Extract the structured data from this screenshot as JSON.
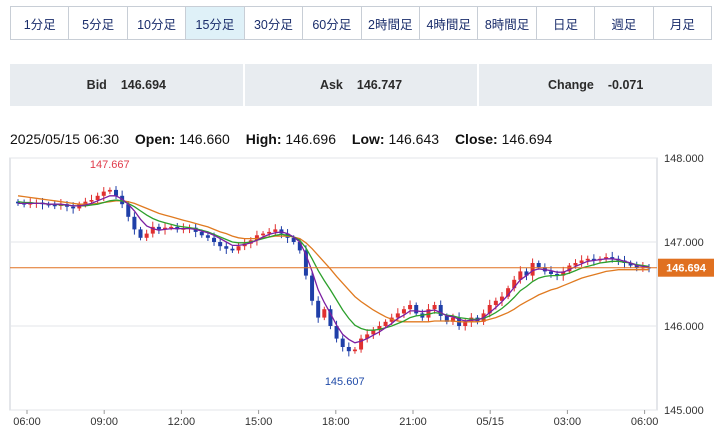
{
  "timeframe_tabs": [
    {
      "label": "1分足",
      "active": false
    },
    {
      "label": "5分足",
      "active": false
    },
    {
      "label": "10分足",
      "active": false
    },
    {
      "label": "15分足",
      "active": true
    },
    {
      "label": "30分足",
      "active": false
    },
    {
      "label": "60分足",
      "active": false
    },
    {
      "label": "2時間足",
      "active": false
    },
    {
      "label": "4時間足",
      "active": false
    },
    {
      "label": "8時間足",
      "active": false
    },
    {
      "label": "日足",
      "active": false
    },
    {
      "label": "週足",
      "active": false
    },
    {
      "label": "月足",
      "active": false
    }
  ],
  "quotes": {
    "bid_label": "Bid",
    "bid_value": "146.694",
    "ask_label": "Ask",
    "ask_value": "146.747",
    "change_label": "Change",
    "change_value": "-0.071"
  },
  "ohlc": {
    "datetime": "2025/05/15 06:30",
    "open_label": "Open:",
    "open": "146.660",
    "high_label": "High:",
    "high": "146.696",
    "low_label": "Low:",
    "low": "146.643",
    "close_label": "Close:",
    "close": "146.694"
  },
  "colors": {
    "up": "#e03030",
    "down": "#1f3fa8",
    "current_line": "#e07020",
    "ma_green": "#2ca02c",
    "ma_orange": "#e07a20",
    "ma_purple": "#7b1fa2",
    "high_label": "#e03a4a",
    "low_label": "#1f4aa8"
  },
  "chart_data": {
    "type": "candlestick",
    "ylim": [
      145.0,
      148.0
    ],
    "y_ticks": [
      "148.000",
      "147.000",
      "146.000",
      "145.000"
    ],
    "x_ticks": [
      "06:00",
      "09:00",
      "12:00",
      "15:00",
      "18:00",
      "21:00",
      "05/15",
      "03:00",
      "06:00"
    ],
    "current_price": "146.694",
    "high_marker": {
      "label": "147.667",
      "value": 147.667
    },
    "low_marker": {
      "label": "145.607",
      "value": 145.607
    },
    "close_series": [
      147.46,
      147.45,
      147.46,
      147.47,
      147.45,
      147.44,
      147.43,
      147.45,
      147.42,
      147.4,
      147.45,
      147.48,
      147.5,
      147.55,
      147.6,
      147.62,
      147.55,
      147.45,
      147.3,
      147.15,
      147.05,
      147.1,
      147.18,
      147.15,
      147.17,
      147.18,
      147.15,
      147.16,
      147.17,
      147.12,
      147.08,
      147.05,
      147.0,
      146.95,
      146.92,
      146.9,
      146.95,
      146.98,
      147.02,
      147.08,
      147.1,
      147.12,
      147.15,
      147.1,
      147.05,
      147.0,
      146.9,
      146.6,
      146.3,
      146.1,
      146.2,
      146.0,
      145.85,
      145.75,
      145.7,
      145.72,
      145.85,
      145.9,
      145.95,
      146.0,
      146.05,
      146.1,
      146.15,
      146.2,
      146.25,
      146.15,
      146.1,
      146.2,
      146.25,
      146.12,
      146.05,
      146.1,
      146.0,
      146.05,
      146.1,
      146.05,
      146.15,
      146.25,
      146.3,
      146.35,
      146.45,
      146.55,
      146.65,
      146.6,
      146.75,
      146.7,
      146.65,
      146.62,
      146.6,
      146.65,
      146.72,
      146.75,
      146.78,
      146.8,
      146.78,
      146.8,
      146.82,
      146.8,
      146.78,
      146.75,
      146.72,
      146.69,
      146.7,
      146.694
    ],
    "ma_fast": [
      147.46,
      147.46,
      147.46,
      147.46,
      147.46,
      147.45,
      147.45,
      147.45,
      147.44,
      147.43,
      147.43,
      147.44,
      147.46,
      147.49,
      147.52,
      147.55,
      147.55,
      147.51,
      147.45,
      147.37,
      147.27,
      147.19,
      147.16,
      147.14,
      147.15,
      147.16,
      147.16,
      147.16,
      147.16,
      147.15,
      147.13,
      147.11,
      147.08,
      147.04,
      147.0,
      146.96,
      146.96,
      146.97,
      146.99,
      147.02,
      147.06,
      147.09,
      147.11,
      147.12,
      147.1,
      147.06,
      147.0,
      146.85,
      146.65,
      146.43,
      146.28,
      146.15,
      146.01,
      145.9,
      145.84,
      145.8,
      145.82,
      145.85,
      145.89,
      145.93,
      145.98,
      146.03,
      146.09,
      146.13,
      146.18,
      146.18,
      146.17,
      146.18,
      146.19,
      146.16,
      146.12,
      146.11,
      146.08,
      146.06,
      146.07,
      146.07,
      146.1,
      146.16,
      146.22,
      146.29,
      146.37,
      146.46,
      146.55,
      146.6,
      146.66,
      146.68,
      146.67,
      146.66,
      146.64,
      146.64,
      146.67,
      146.71,
      146.74,
      146.77,
      146.78,
      146.79,
      146.8,
      146.8,
      146.79,
      146.77,
      146.75,
      146.72,
      146.71,
      146.7
    ],
    "ma_mid": [
      147.48,
      147.47,
      147.47,
      147.46,
      147.46,
      147.45,
      147.45,
      147.44,
      147.44,
      147.43,
      147.43,
      147.43,
      147.44,
      147.45,
      147.47,
      147.49,
      147.5,
      147.49,
      147.46,
      147.42,
      147.37,
      147.32,
      147.28,
      147.25,
      147.23,
      147.21,
      147.19,
      147.18,
      147.17,
      147.16,
      147.14,
      147.12,
      147.09,
      147.06,
      147.03,
      147.0,
      146.99,
      146.99,
      147.0,
      147.02,
      147.04,
      147.06,
      147.08,
      147.09,
      147.08,
      147.06,
      147.02,
      146.93,
      146.8,
      146.66,
      146.54,
      146.43,
      146.31,
      146.19,
      146.09,
      146.01,
      145.97,
      145.95,
      145.95,
      145.96,
      145.98,
      146.0,
      146.03,
      146.06,
      146.1,
      146.12,
      146.13,
      146.14,
      146.16,
      146.15,
      146.13,
      146.12,
      146.1,
      146.09,
      146.08,
      146.08,
      146.09,
      146.12,
      146.16,
      146.21,
      146.27,
      146.34,
      146.42,
      146.47,
      146.53,
      146.57,
      146.59,
      146.6,
      146.6,
      146.61,
      146.63,
      146.66,
      146.69,
      146.71,
      146.73,
      146.75,
      146.76,
      146.77,
      146.77,
      146.76,
      146.75,
      146.73,
      146.72,
      146.71
    ],
    "ma_slow": [
      147.55,
      147.54,
      147.53,
      147.52,
      147.51,
      147.5,
      147.49,
      147.48,
      147.47,
      147.46,
      147.45,
      147.45,
      147.45,
      147.46,
      147.47,
      147.48,
      147.49,
      147.49,
      147.48,
      147.46,
      147.43,
      147.4,
      147.37,
      147.34,
      147.32,
      147.3,
      147.28,
      147.26,
      147.24,
      147.22,
      147.2,
      147.18,
      147.15,
      147.12,
      147.1,
      147.07,
      147.05,
      147.04,
      147.04,
      147.04,
      147.05,
      147.06,
      147.07,
      147.07,
      147.07,
      147.06,
      147.04,
      146.99,
      146.92,
      146.84,
      146.76,
      146.68,
      146.59,
      146.51,
      146.43,
      146.35,
      146.29,
      146.24,
      146.19,
      146.15,
      146.11,
      146.08,
      146.06,
      146.05,
      146.05,
      146.05,
      146.05,
      146.05,
      146.06,
      146.06,
      146.06,
      146.06,
      146.05,
      146.05,
      146.05,
      146.05,
      146.06,
      146.08,
      146.1,
      146.13,
      146.16,
      146.2,
      146.25,
      146.29,
      146.33,
      146.37,
      146.4,
      146.43,
      146.45,
      146.48,
      146.51,
      146.54,
      146.57,
      146.59,
      146.61,
      146.63,
      146.65,
      146.66,
      146.67,
      146.67,
      146.67,
      146.67,
      146.67,
      146.67
    ]
  }
}
